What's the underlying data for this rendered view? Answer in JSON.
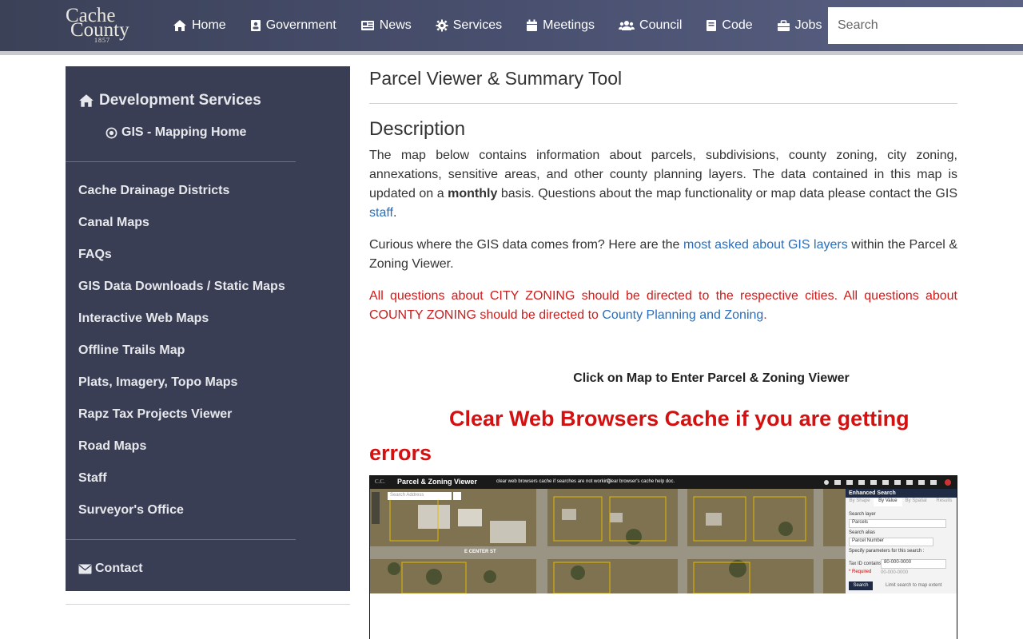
{
  "logo": {
    "line1": "Cache",
    "line2": "County",
    "est": "1857"
  },
  "nav": {
    "items": [
      {
        "label": "Home",
        "icon": "home-icon"
      },
      {
        "label": "Government",
        "icon": "address-book-icon"
      },
      {
        "label": "News",
        "icon": "newspaper-icon"
      },
      {
        "label": "Services",
        "icon": "gear-icon"
      },
      {
        "label": "Meetings",
        "icon": "calendar-icon"
      },
      {
        "label": "Council",
        "icon": "users-icon"
      },
      {
        "label": "Code",
        "icon": "book-icon"
      },
      {
        "label": "Jobs",
        "icon": "briefcase-icon"
      }
    ],
    "search_placeholder": "Search"
  },
  "sidebar": {
    "heading": "Development Services",
    "sub": "GIS - Mapping Home",
    "items": [
      "Cache Drainage Districts",
      "Canal Maps",
      "FAQs",
      "GIS Data Downloads / Static Maps",
      "Interactive Web Maps",
      "Offline Trails Map",
      "Plats, Imagery, Topo Maps",
      "Rapz Tax Projects Viewer",
      "Road Maps",
      "Staff",
      "Surveyor's Office"
    ],
    "contact": "Contact"
  },
  "main": {
    "title": "Parcel Viewer & Summary Tool",
    "description_heading": "Description",
    "p1_a": "The map below contains information about parcels, subdivisions, county zoning, city zoning, annexations, sensitive areas, and other county planning layers. The data contained in this map is updated on a ",
    "p1_bold": "monthly",
    "p1_b": " basis.  Questions about the map functionality or map data please contact the GIS ",
    "p1_link": "staff",
    "p1_c": ".",
    "p2_a": "Curious where the GIS data comes from? Here are the ",
    "p2_link": "most asked about GIS layers",
    "p2_b": " within the Parcel & Zoning Viewer.",
    "p3_a": "All questions about CITY ZONING should be directed to the respective cities. All questions about COUNTY ZONING should be directed to ",
    "p3_link": "County Planning and Zoning",
    "p3_b": ".",
    "click_line": "Click on Map to Enter Parcel & Zoning Viewer",
    "warning": "Clear Web Browsers Cache if you are getting errors"
  },
  "map_preview": {
    "app_title": "Parcel & Zoning Viewer",
    "notice": "clear web browsers cache if searches are not working",
    "help": "Clear browser's cache help doc.",
    "search_placeholder": "Search Address",
    "panel_title": "Enhanced Search",
    "tabs": [
      "By Shape",
      "By Value",
      "By Spatial",
      "Results"
    ],
    "search_layer_label": "Search layer",
    "search_layer_value": "Parcels",
    "search_alias_label": "Search alias",
    "search_alias_value": "Parcel Number",
    "params_label": "Specify parameters for this search :",
    "tax_label": "Tax ID contains",
    "tax_value": "80-000-0000",
    "required": "* Required",
    "tax_hint": "00-000-0000",
    "search_button": "Search",
    "limit_label": "Limit search to map extent",
    "street_label": "E CENTER ST"
  },
  "colors": {
    "topbar": "#454b66",
    "sidebar": "#393e54",
    "link": "#2a6ebb",
    "warning": "#d41010"
  }
}
